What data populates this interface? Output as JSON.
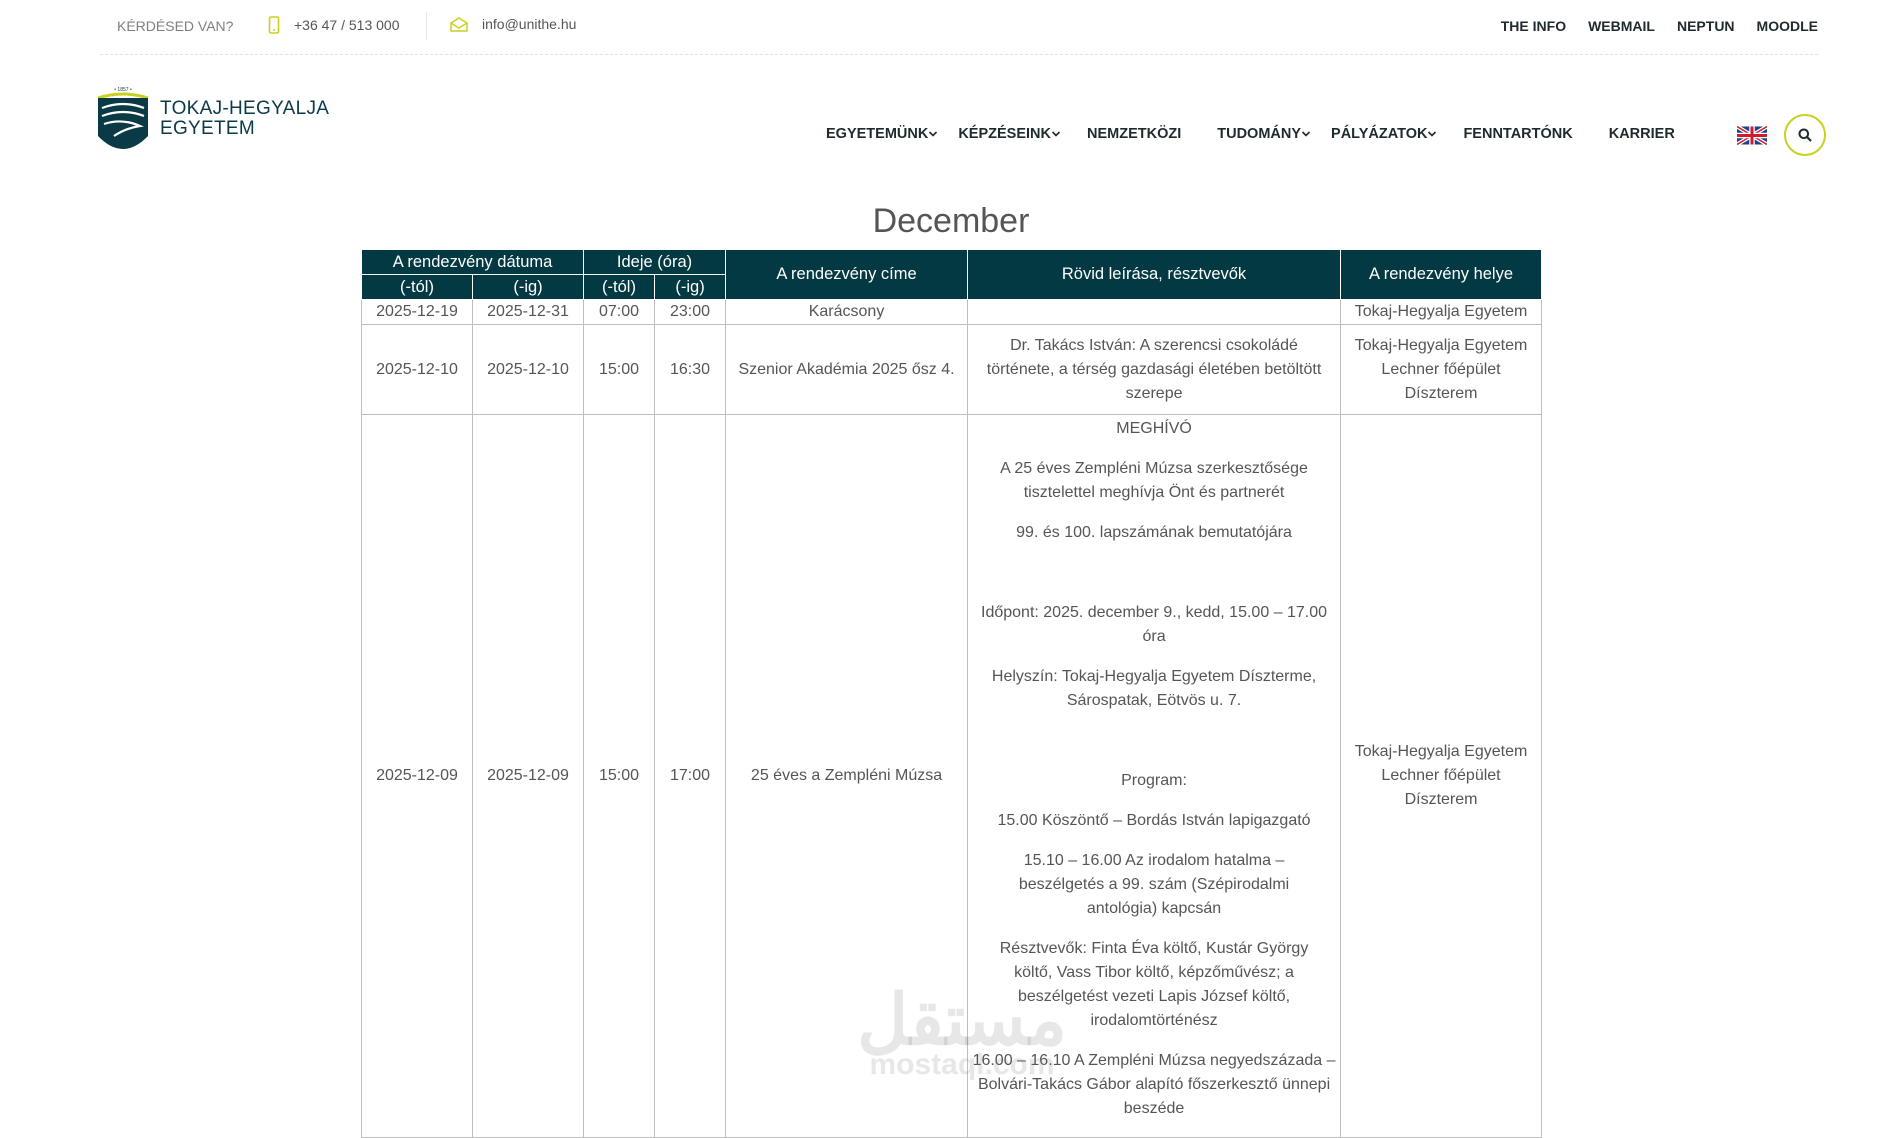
{
  "topbar": {
    "question": "KÉRDÉSED VAN?",
    "phone": "+36 47 / 513 000",
    "email": "info@unithe.hu",
    "links": [
      "THE INFO",
      "WEBMAIL",
      "NEPTUN",
      "MOODLE"
    ]
  },
  "logo": {
    "year_top": "1857",
    "year_bottom": "2021",
    "line1": "TOKAJ-HEGYALJA",
    "line2": "EGYETEM"
  },
  "nav": {
    "items": [
      {
        "label": "EGYETEMÜNK",
        "dropdown": true
      },
      {
        "label": "KÉPZÉSEINK",
        "dropdown": true
      },
      {
        "label": "NEMZETKÖZI",
        "dropdown": false
      },
      {
        "label": "TUDOMÁNY",
        "dropdown": true
      },
      {
        "label": "PÁLYÁZATOK",
        "dropdown": true
      },
      {
        "label": "FENNTARTÓNK",
        "dropdown": false
      },
      {
        "label": "KARRIER",
        "dropdown": false
      }
    ]
  },
  "content": {
    "month": "December",
    "headers": {
      "date_group": "A rendezvény dátuma",
      "time_group": "Ideje (óra)",
      "from": "(-tól)",
      "to": "(-ig)",
      "title": "A rendezvény címe",
      "desc": "Rövid leírása, résztvevők",
      "place": "A rendezvény helye"
    },
    "rows": [
      {
        "date_from": "2025-12-19",
        "date_to": "2025-12-31",
        "time_from": "07:00",
        "time_to": "23:00",
        "title": "Karácsony",
        "desc": "",
        "place": "Tokaj-Hegyalja Egyetem"
      },
      {
        "date_from": "2025-12-10",
        "date_to": "2025-12-10",
        "time_from": "15:00",
        "time_to": "16:30",
        "title": "Szenior Akadémia 2025 ősz 4.",
        "desc": "Dr. Takács István: A szerencsi csokoládé története, a térség gazdasági életében betöltött szerepe",
        "place": "Tokaj-Hegyalja Egyetem Lechner főépület Díszterem"
      },
      {
        "date_from": "2025-12-09",
        "date_to": "2025-12-09",
        "time_from": "15:00",
        "time_to": "17:00",
        "title": "25 éves a Zempléni Múzsa",
        "desc_paragraphs": [
          "MEGHÍVÓ",
          "A 25 éves Zempléni Múzsa szerkesztősége tisztelettel meghívja Önt és partnerét",
          "99. és 100. lapszámának bemutatójára",
          "",
          "Időpont: 2025. december 9., kedd, 15.00 – 17.00 óra",
          "Helyszín: Tokaj-Hegyalja Egyetem Díszterme, Sárospatak, Eötvös u. 7.",
          "",
          "Program:",
          "15.00 Köszöntő – Bordás István lapigazgató",
          "15.10 – 16.00 Az irodalom hatalma – beszélgetés a 99. szám (Szépirodalmi antológia) kapcsán",
          "Résztvevők: Finta Éva költő, Kustár György költő, Vass Tibor költő, képzőművész; a beszélgetést vezeti Lapis József költő, irodalomtörténész",
          "16.00 – 16.10 A Zempléni Múzsa negyedszázada – Bolvári-Takács Gábor alapító főszerkesztő ünnepi beszéde"
        ],
        "place": "Tokaj-Hegyalja Egyetem Lechner főépület Díszterem"
      }
    ]
  },
  "watermark": {
    "text": "مستقل",
    "sub": "mostaql.com"
  },
  "colors": {
    "header_bg": "#033942",
    "accent": "#c8d11f",
    "brand": "#0b3a47"
  }
}
